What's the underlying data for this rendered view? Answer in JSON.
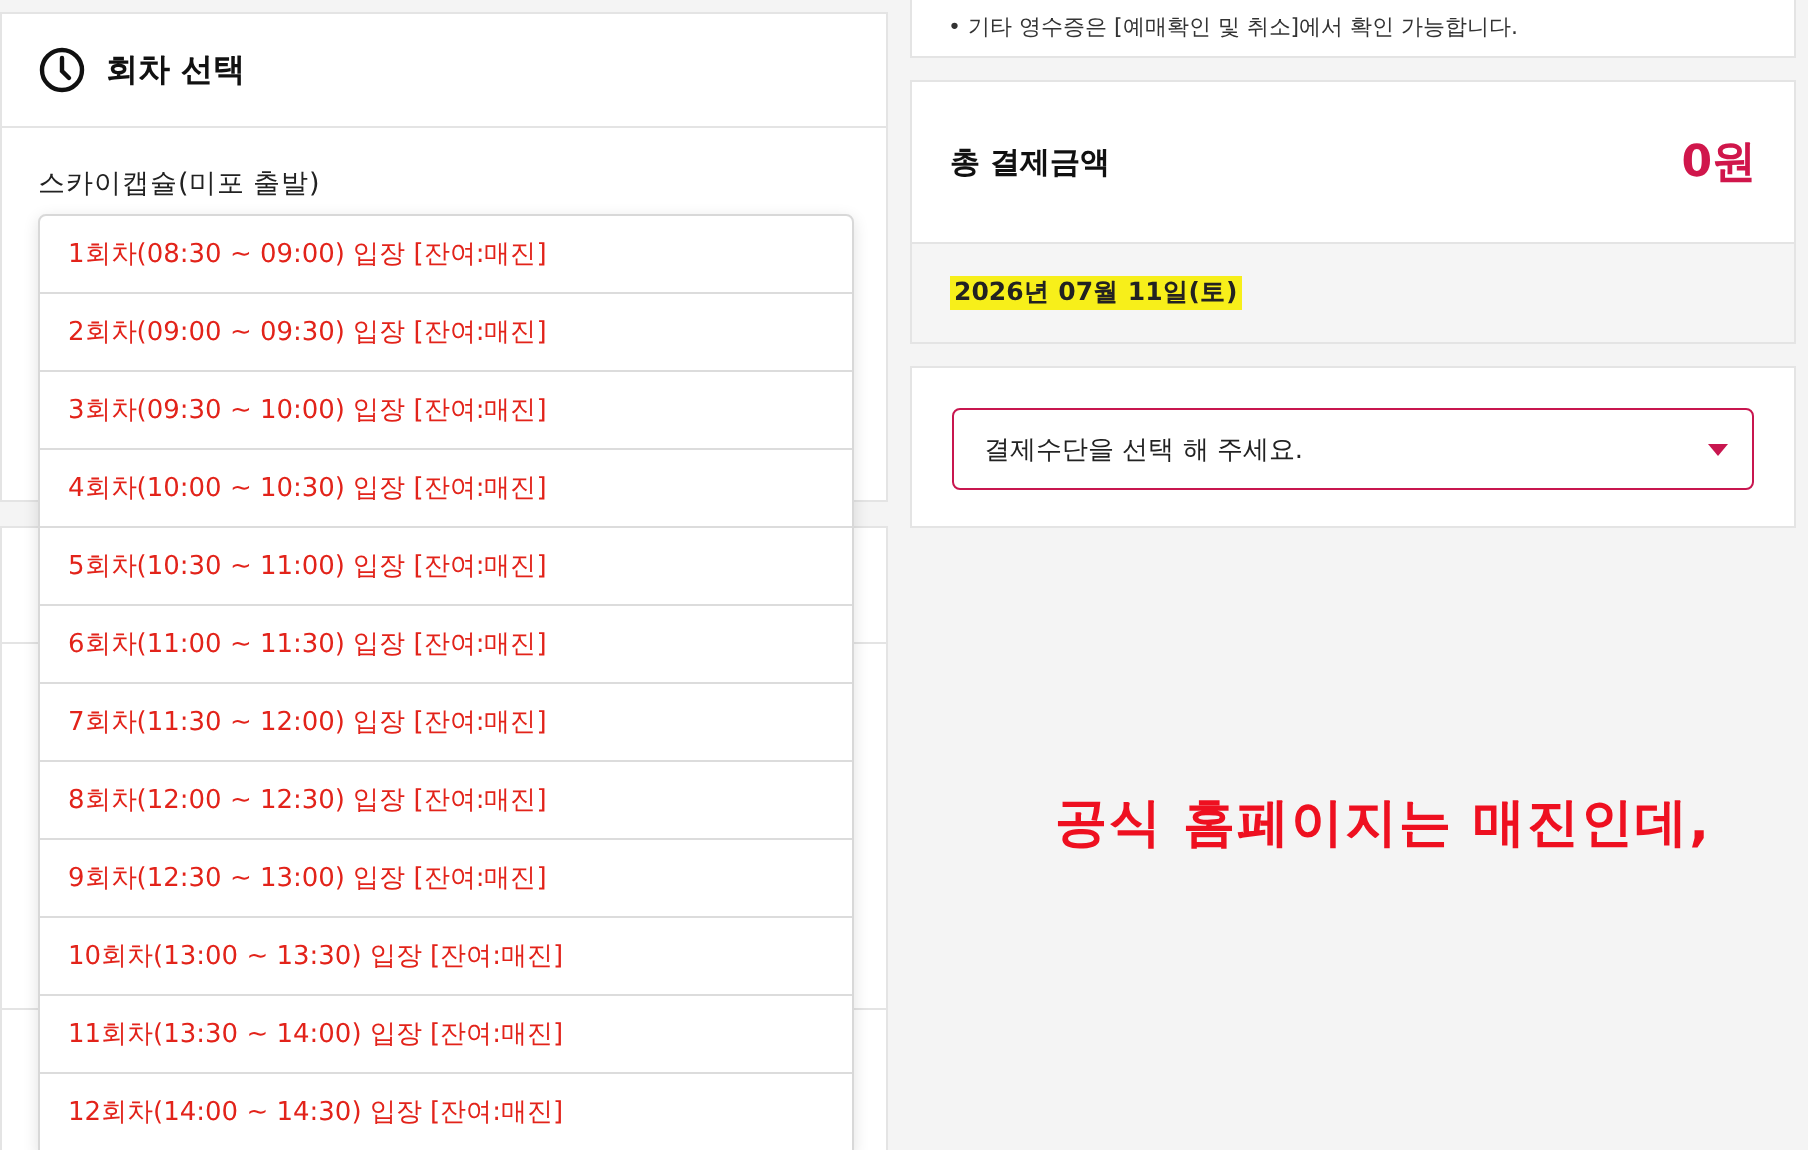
{
  "notice": "• 기타 영수증은 [예매확인 및 취소]에서 확인 가능합니다.",
  "round_select": {
    "title": "회차 선택",
    "product": "스카이캡슐(미포 출발)",
    "options": [
      {
        "label": "1회차(08:30 ~ 09:00) 입장 [잔여:매진]",
        "sold_out": true
      },
      {
        "label": "2회차(09:00 ~ 09:30) 입장 [잔여:매진]",
        "sold_out": true
      },
      {
        "label": "3회차(09:30 ~ 10:00) 입장 [잔여:매진]",
        "sold_out": true
      },
      {
        "label": "4회차(10:00 ~ 10:30) 입장 [잔여:매진]",
        "sold_out": true
      },
      {
        "label": "5회차(10:30 ~ 11:00) 입장 [잔여:매진]",
        "sold_out": true
      },
      {
        "label": "6회차(11:00 ~ 11:30) 입장 [잔여:매진]",
        "sold_out": true
      },
      {
        "label": "7회차(11:30 ~ 12:00) 입장 [잔여:매진]",
        "sold_out": true
      },
      {
        "label": "8회차(12:00 ~ 12:30) 입장 [잔여:매진]",
        "sold_out": true
      },
      {
        "label": "9회차(12:30 ~ 13:00) 입장 [잔여:매진]",
        "sold_out": true
      },
      {
        "label": "10회차(13:00 ~ 13:30) 입장 [잔여:매진]",
        "sold_out": true
      },
      {
        "label": "11회차(13:30 ~ 14:00) 입장 [잔여:매진]",
        "sold_out": true
      },
      {
        "label": "12회차(14:00 ~ 14:30) 입장 [잔여:매진]",
        "sold_out": true
      }
    ]
  },
  "total": {
    "label": "총 결제금액",
    "amount": "0원",
    "date": "2026년 07월 11일(토)"
  },
  "payment": {
    "placeholder": "결제수단을 선택 해 주세요."
  },
  "annotation": "공식 홈페이지는 매진인데,"
}
